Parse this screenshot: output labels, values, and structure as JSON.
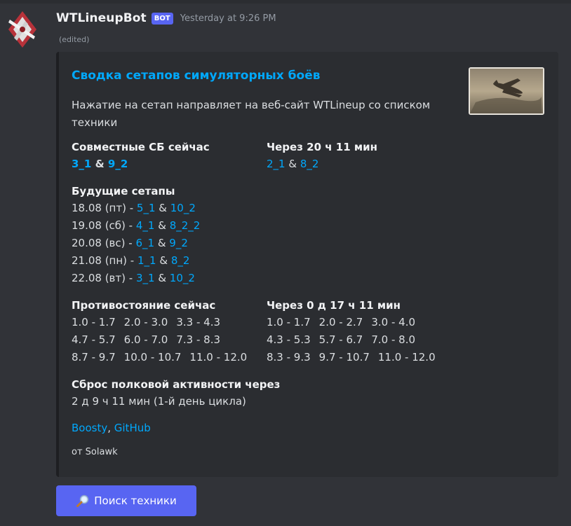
{
  "message": {
    "username": "WTLineupBot",
    "bot_tag": "BOT",
    "timestamp": "Yesterday at 9:26 PM",
    "edited_label": "(edited)"
  },
  "embed": {
    "title": "Сводка сетапов симуляторных боёв",
    "description": "Нажатие на сетап направляет на веб-сайт WTLineup со списком техники",
    "now_field": {
      "name": "Совместные СБ сейчас",
      "left": "3_1",
      "sep": " & ",
      "right": "9_2"
    },
    "next_field": {
      "name": "Через 20 ч 11 мин",
      "left": "2_1",
      "sep": " & ",
      "right": "8_2"
    },
    "future_field": {
      "name": "Будущие сетапы",
      "rows": [
        {
          "date": "18.08 (пт) - ",
          "a": "5_1",
          "sep": " & ",
          "b": "10_2"
        },
        {
          "date": "19.08 (сб) - ",
          "a": "4_1",
          "sep": " & ",
          "b": "8_2_2"
        },
        {
          "date": "20.08 (вс) - ",
          "a": "6_1",
          "sep": " & ",
          "b": "9_2"
        },
        {
          "date": "21.08 (пн) - ",
          "a": "1_1",
          "sep": " & ",
          "b": "8_2"
        },
        {
          "date": "22.08 (вт) - ",
          "a": "3_1",
          "sep": " & ",
          "b": "10_2"
        }
      ]
    },
    "confront_now": {
      "name": "Противостояние сейчас",
      "rows": [
        [
          "1.0 - 1.7",
          "2.0 - 3.0",
          "3.3 - 4.3"
        ],
        [
          "4.7 - 5.7",
          "6.0 - 7.0",
          "7.3 - 8.3"
        ],
        [
          "8.7 - 9.7",
          "10.0 - 10.7",
          "11.0 - 12.0"
        ]
      ]
    },
    "confront_next": {
      "name": "Через 0 д 17 ч 11 мин",
      "rows": [
        [
          "1.0 - 1.7",
          "2.0 - 2.7",
          "3.0 - 4.0"
        ],
        [
          "4.3 - 5.3",
          "5.7 - 6.7",
          "7.0 - 8.0"
        ],
        [
          "8.3 - 9.3",
          "9.7 - 10.7",
          "11.0 - 12.0"
        ]
      ]
    },
    "reset_field": {
      "name": "Сброс полковой активности через",
      "value": "2 д 9 ч 11 мин (1-й день цикла)"
    },
    "links": {
      "boosty": "Boosty",
      "comma": ", ",
      "github": "GitHub"
    },
    "footer": "от Solawk"
  },
  "button": {
    "icon": "magnifier-icon",
    "label": "Поиск техники"
  },
  "colors": {
    "background": "#313338",
    "embed_bg": "#2b2d31",
    "link": "#00a8fc",
    "blurple": "#5865f2"
  }
}
